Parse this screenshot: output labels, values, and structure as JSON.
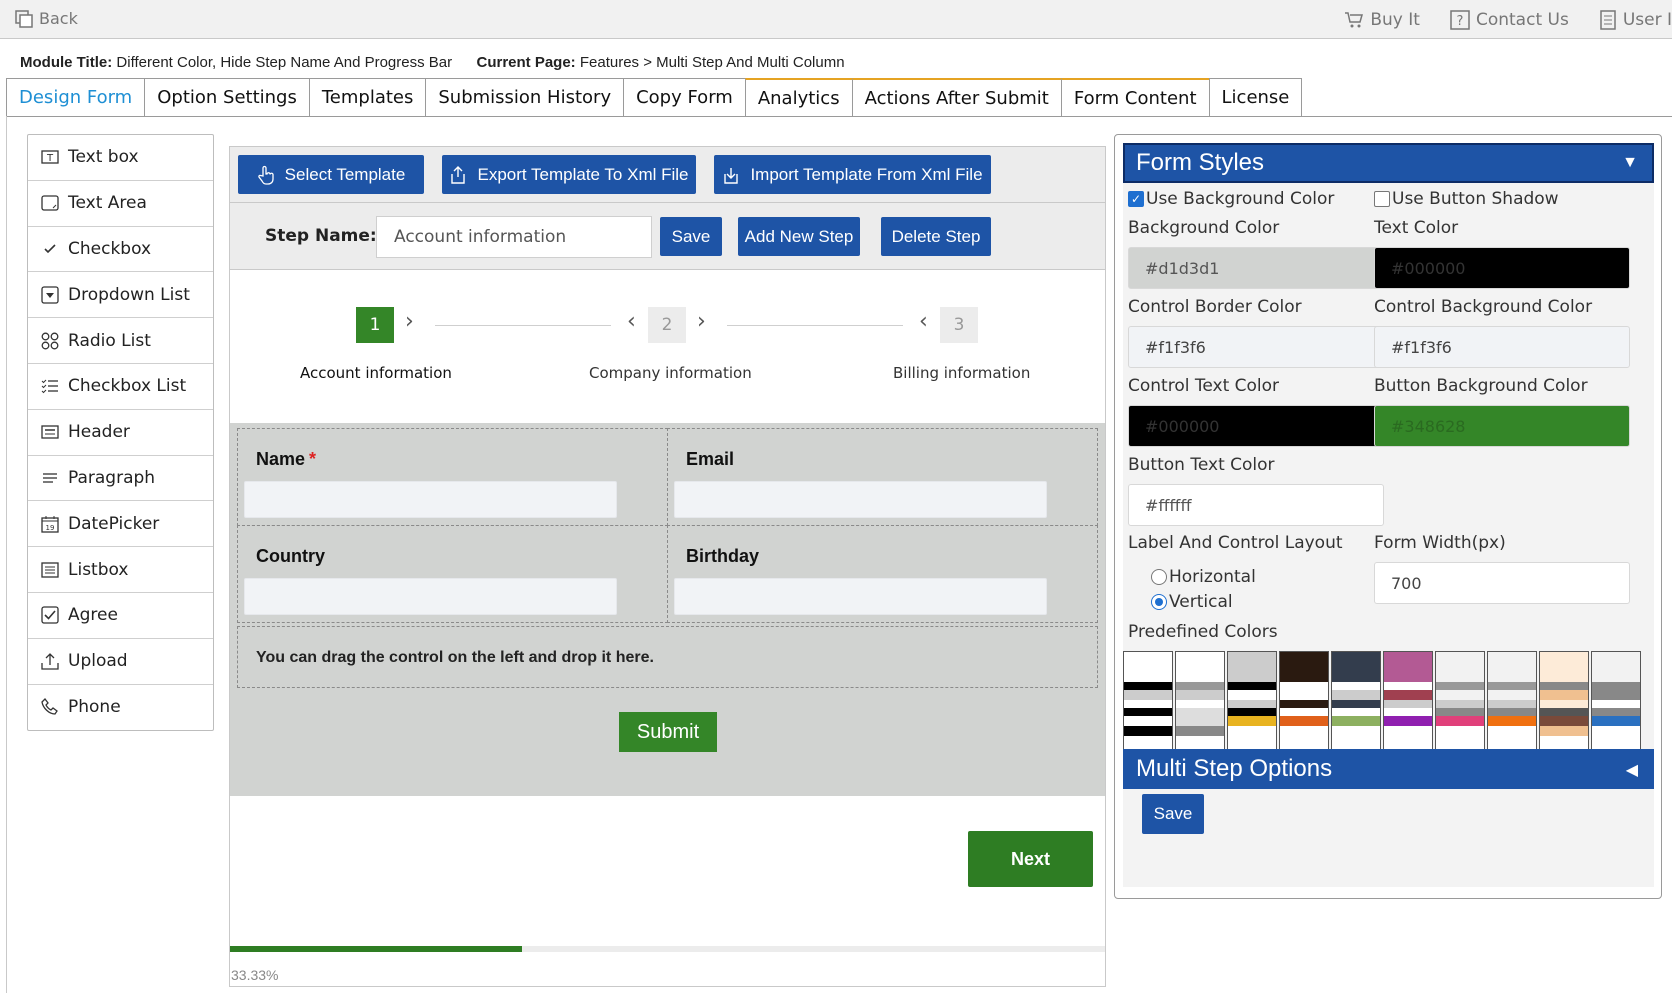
{
  "topbar": {
    "back": "Back",
    "buy_it": "Buy It",
    "contact_us": "Contact Us",
    "user": "User I"
  },
  "module": {
    "title_label": "Module Title:",
    "title_value": "Different Color, Hide Step Name And Progress Bar",
    "page_label": "Current Page:",
    "page_value": "Features > Multi Step And Multi Column"
  },
  "tabs": [
    {
      "label": "Design Form"
    },
    {
      "label": "Option Settings"
    },
    {
      "label": "Templates"
    },
    {
      "label": "Submission History"
    },
    {
      "label": "Copy Form"
    },
    {
      "label": "Analytics"
    },
    {
      "label": "Actions After Submit"
    },
    {
      "label": "Form Content"
    },
    {
      "label": "License"
    }
  ],
  "toolbox": [
    {
      "label": "Text box",
      "icon": "textbox-icon"
    },
    {
      "label": "Text Area",
      "icon": "textarea-icon"
    },
    {
      "label": "Checkbox",
      "icon": "check-icon"
    },
    {
      "label": "Dropdown List",
      "icon": "dropdown-icon"
    },
    {
      "label": "Radio List",
      "icon": "radio-list-icon"
    },
    {
      "label": "Checkbox List",
      "icon": "checkbox-list-icon"
    },
    {
      "label": "Header",
      "icon": "header-icon"
    },
    {
      "label": "Paragraph",
      "icon": "paragraph-icon"
    },
    {
      "label": "DatePicker",
      "icon": "calendar-icon"
    },
    {
      "label": "Listbox",
      "icon": "listbox-icon"
    },
    {
      "label": "Agree",
      "icon": "agree-icon"
    },
    {
      "label": "Upload",
      "icon": "upload-icon"
    },
    {
      "label": "Phone",
      "icon": "phone-icon"
    }
  ],
  "center": {
    "select_template": "Select Template",
    "export_template": "Export Template To Xml File",
    "import_template": "Import Template From Xml File",
    "step_name_label": "Step Name:",
    "step_name_value": "Account information",
    "save": "Save",
    "add_new_step": "Add New Step",
    "delete_step": "Delete Step",
    "steps": [
      {
        "num": "1",
        "label": "Account information"
      },
      {
        "num": "2",
        "label": "Company information"
      },
      {
        "num": "3",
        "label": "Billing information"
      }
    ],
    "fields": {
      "name": "Name",
      "required_mark": "*",
      "email": "Email",
      "country": "Country",
      "birthday": "Birthday"
    },
    "drop_hint": "You can drag the control on the left and drop it here.",
    "submit": "Submit",
    "next": "Next",
    "progress": 0.3333,
    "progress_text": "33.33%"
  },
  "styles": {
    "heading": "Form Styles",
    "use_bg_color": "Use Background Color",
    "use_button_shadow": "Use Button Shadow",
    "bg_color_label": "Background Color",
    "bg_color_value": "#d1d3d1",
    "text_color_label": "Text Color",
    "text_color_value": "#000000",
    "ctrl_border_label": "Control Border Color",
    "ctrl_border_value": "#f1f3f6",
    "ctrl_bg_label": "Control Background Color",
    "ctrl_bg_value": "#f1f3f6",
    "ctrl_text_label": "Control Text Color",
    "ctrl_text_value": "#000000",
    "btn_bg_label": "Button Background Color",
    "btn_bg_value": "#348628",
    "btn_text_label": "Button Text Color",
    "btn_text_value": "#ffffff",
    "layout_label": "Label And Control Layout",
    "horizontal": "Horizontal",
    "vertical": "Vertical",
    "width_label": "Form Width(px)",
    "width_value": "700",
    "predefined_label": "Predefined Colors",
    "multi_step_heading": "Multi Step Options",
    "save": "Save"
  },
  "colors": {
    "accent_blue": "#1e54a6",
    "button_green": "#348628",
    "form_bg": "#d1d3d1",
    "tab_active": "#1e8fd4"
  }
}
